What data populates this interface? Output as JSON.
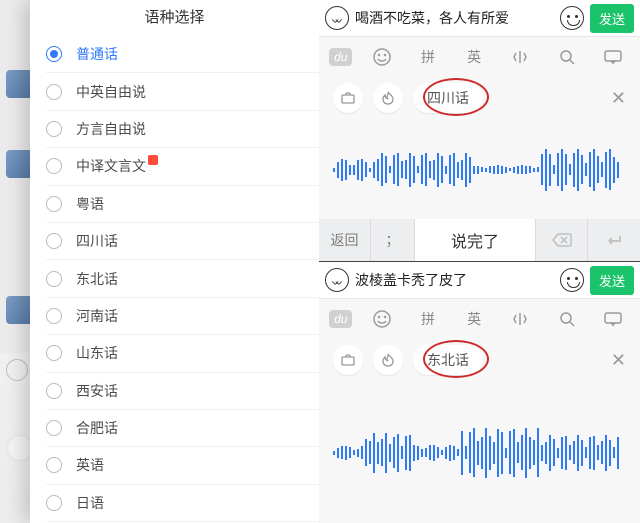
{
  "left": {
    "title": "语种选择",
    "options": [
      {
        "label": "普通话",
        "selected": true
      },
      {
        "label": "中英自由说",
        "selected": false
      },
      {
        "label": "方言自由说",
        "selected": false
      },
      {
        "label": "中译文言文",
        "selected": false,
        "new": true
      },
      {
        "label": "粤语",
        "selected": false
      },
      {
        "label": "四川话",
        "selected": false
      },
      {
        "label": "东北话",
        "selected": false
      },
      {
        "label": "河南话",
        "selected": false
      },
      {
        "label": "山东话",
        "selected": false
      },
      {
        "label": "西安话",
        "selected": false
      },
      {
        "label": "合肥话",
        "selected": false
      },
      {
        "label": "英语",
        "selected": false
      },
      {
        "label": "日语",
        "selected": false
      }
    ]
  },
  "kb_row1": {
    "du": "du",
    "pin": "拼",
    "ying": "英"
  },
  "panel_top": {
    "input_text": "喝酒不吃菜，各人有所爱",
    "send_label": "发送",
    "dialect_tag": "四川话",
    "back_label": "返回",
    "semi_label": "；",
    "done_label": "说完了"
  },
  "panel_bottom": {
    "input_text": "波棱盖卡秃了皮了",
    "send_label": "发送",
    "dialect_tag": "东北话"
  }
}
